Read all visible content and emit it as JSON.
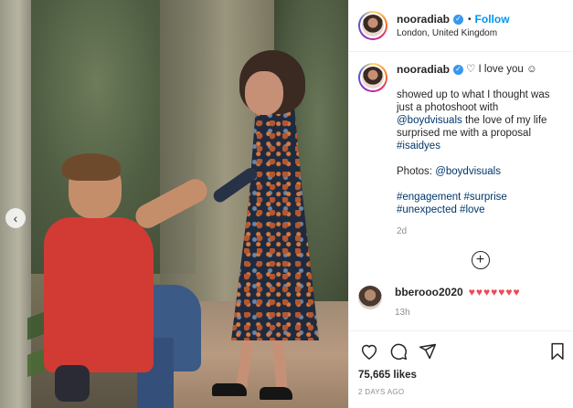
{
  "post": {
    "username": "nooradiab",
    "follow_label": "Follow",
    "location": "London, United Kingdom"
  },
  "caption": {
    "username": "nooradiab",
    "first_line_text": "♡ I love you ☺",
    "paragraph1_prefix": "showed up to what I thought was just a photoshoot with ",
    "paragraph1_mention": "@boydvisuals",
    "paragraph1_middle": " the love of my life surprised me with a proposal ",
    "paragraph1_hashtag": "#isaidyes",
    "photos_label": "Photos: ",
    "photos_mention": "@boydvisuals",
    "hashtags": "#engagement #surprise #unexpected #love",
    "time": "2d"
  },
  "comment": {
    "username": "bberooo2020",
    "text": "♥♥♥♥♥♥♥",
    "time": "13h"
  },
  "stats": {
    "likes": "75,665 likes",
    "date": "2 DAYS AGO"
  },
  "colors": {
    "link": "#00376b",
    "follow": "#0095f6",
    "heart": "#ed4956",
    "verified": "#3897f0"
  },
  "icons": [
    "chevron-left-icon",
    "verified-icon",
    "heart-icon",
    "comment-icon",
    "share-icon",
    "bookmark-icon",
    "plus-circle-icon"
  ]
}
